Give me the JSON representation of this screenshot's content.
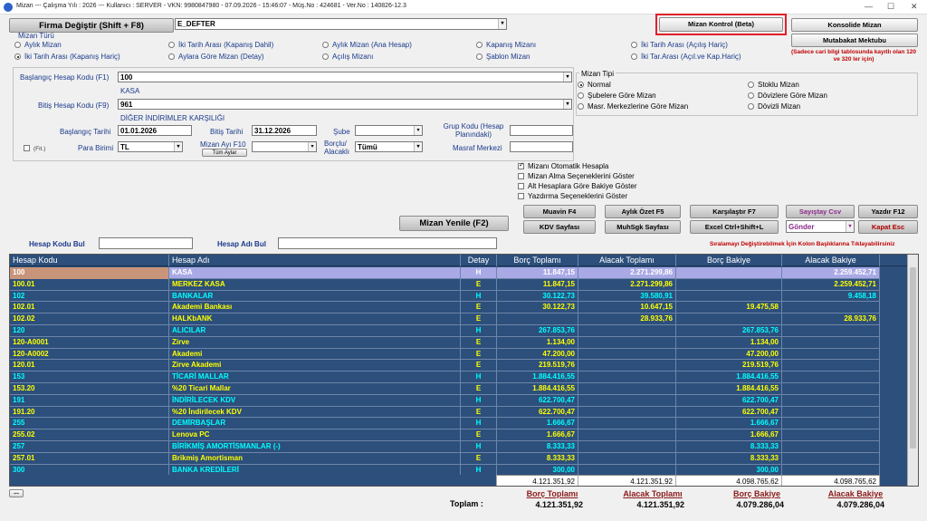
{
  "window": {
    "app_name": "Mizan",
    "info": "Mizan  ---  Çalışma Yılı : 2026  ---  Kullanıcı : SERVER - VKN: 9980847980 - 07.09.2026 - 15:46:07 - Müş.No : 424681 - Ver.No : 140826-12.3",
    "minimize": "—",
    "maximize": "☐",
    "close": "✕"
  },
  "toolbar": {
    "firma_degistir": "Firma Değiştir (Shift + F8)",
    "firma_value": "E_DEFTER",
    "mizan_kontrol": "Mizan Kontrol (Beta)",
    "konsolide": "Konsolide Mizan",
    "mutabakat": "Mutabakat Mektubu",
    "note": "(Sadece cari bilgi tablosunda kayıtlı olan 120 ve 320 ler için)"
  },
  "mizan_turu": {
    "label": "Mizan Türü",
    "options": [
      {
        "label": "Aylık Mizan",
        "selected": false
      },
      {
        "label": "İki Tarih Arası (Kapanış Dahil)",
        "selected": false
      },
      {
        "label": "Aylık Mizan (Ana Hesap)",
        "selected": false
      },
      {
        "label": "Kapanış Mizanı",
        "selected": false
      },
      {
        "label": "İki Tarih Arası (Açılış Hariç)",
        "selected": false
      },
      {
        "label": "İki Tarih Arası (Kapanış Hariç)",
        "selected": true
      },
      {
        "label": "Aylara Göre Mizan (Detay)",
        "selected": false
      },
      {
        "label": "Açılış Mizanı",
        "selected": false
      },
      {
        "label": "Şablon Mizan",
        "selected": false
      },
      {
        "label": "İki Tar.Arası (Açıl.ve Kap.Hariç)",
        "selected": false
      }
    ]
  },
  "filters": {
    "bas_hesap_label": "Başlangıç Hesap Kodu (F1)",
    "bas_hesap_value": "100",
    "bas_hesap_name": "KASA",
    "bit_hesap_label": "Bitiş Hesap Kodu (F9)",
    "bit_hesap_value": "961",
    "bit_hesap_name": "DİĞER İNDİRİMLER KARŞILIĞI",
    "bas_tarihi_label": "Başlangıç Tarihi",
    "bas_tarihi_value": "01.01.2026",
    "bit_tarihi_label": "Bitiş Tarihi",
    "bit_tarihi_value": "31.12.2026",
    "sube_label": "Şube",
    "sube_value": "",
    "grup_kodu_label": "Grup Kodu   (Hesap Planındaki)",
    "grup_kodu_value": "",
    "fit_label": "(Fit.)",
    "para_birimi_label": "Para Birimi",
    "para_birimi_value": "TL",
    "mizan_ayi_label": "Mizan Ayı F10",
    "tum_aylar": "Tüm Aylar",
    "mizan_ayi_value": "",
    "borclu_label": "Borçlu/ Alacaklı",
    "borclu_value": "Tümü",
    "masraf_label": "Masraf Merkezi",
    "masraf_value": ""
  },
  "mizan_tipi": {
    "label": "Mizan Tipi",
    "options": [
      {
        "label": "Normal",
        "selected": true
      },
      {
        "label": "Stoklu Mizan",
        "selected": false
      },
      {
        "label": "Şubelere Göre Mizan",
        "selected": false
      },
      {
        "label": "Dövizlere Göre Mizan",
        "selected": false
      },
      {
        "label": "Masr. Merkezlerine Göre Mizan",
        "selected": false
      },
      {
        "label": "Dövizli Mizan",
        "selected": false
      }
    ]
  },
  "options": [
    {
      "label": "Mizanı Otomatik Hesapla",
      "checked": true
    },
    {
      "label": "Mizan Alma Seçeneklerini Göster",
      "checked": false
    },
    {
      "label": "Alt Hesaplara Göre Bakiye Göster",
      "checked": false
    },
    {
      "label": "Yazdırma Seçeneklerini Göster",
      "checked": false
    }
  ],
  "actions": {
    "mizan_yenile": "Mizan Yenile (F2)",
    "muavin": "Muavin F4",
    "aylik_ozet": "Aylık Özet F5",
    "karsilastir": "Karşılaştır F7",
    "sayistay": "Sayıştay Csv",
    "yazdir": "Yazdır F12",
    "kdv": "KDV Sayfası",
    "muhsgk": "MuhSgk Sayfası",
    "excel": "Excel Ctrl+Shift+L",
    "gonder": "Gönder",
    "kapat": "Kapat Esc"
  },
  "search": {
    "hesap_kodu_label": "Hesap Kodu Bul",
    "hesap_kodu_value": "",
    "hesap_adi_label": "Hesap Adı Bul",
    "hesap_adi_value": "",
    "sort_hint": "Sıralamayı Değiştirebilmek İçin Kolon Başlıklarına Tıklayabilirsiniz"
  },
  "table": {
    "headers": [
      "Hesap Kodu",
      "Hesap Adı",
      "Detay",
      "Borç Toplamı",
      "Alacak Toplamı",
      "Borç Bakiye",
      "Alacak Bakiye"
    ],
    "rows": [
      {
        "code": "100",
        "name": "KASA",
        "detay": "H",
        "borc": "11.847,15",
        "alacak": "2.271.299,86",
        "borc_bak": "",
        "alacak_bak": "2.259.452,71",
        "color": "#ffffff",
        "selected": true
      },
      {
        "code": "100.01",
        "name": "MERKEZ KASA",
        "detay": "E",
        "borc": "11.847,15",
        "alacak": "2.271.299,86",
        "borc_bak": "",
        "alacak_bak": "2.259.452,71",
        "color": "#ffff00"
      },
      {
        "code": "102",
        "name": "BANKALAR",
        "detay": "H",
        "borc": "30.122,73",
        "alacak": "39.580,91",
        "borc_bak": "",
        "alacak_bak": "9.458,18",
        "color": "#00ffff"
      },
      {
        "code": "102.01",
        "name": "Akademi Bankası",
        "detay": "E",
        "borc": "30.122,73",
        "alacak": "10.647,15",
        "borc_bak": "19.475,58",
        "alacak_bak": "",
        "color": "#ffff00"
      },
      {
        "code": "102.02",
        "name": "HALKbANK",
        "detay": "E",
        "borc": "",
        "alacak": "28.933,76",
        "borc_bak": "",
        "alacak_bak": "28.933,76",
        "color": "#ffff00"
      },
      {
        "code": "120",
        "name": "ALICILAR",
        "detay": "H",
        "borc": "267.853,76",
        "alacak": "",
        "borc_bak": "267.853,76",
        "alacak_bak": "",
        "color": "#00ffff"
      },
      {
        "code": "120-A0001",
        "name": "Zirve",
        "detay": "E",
        "borc": "1.134,00",
        "alacak": "",
        "borc_bak": "1.134,00",
        "alacak_bak": "",
        "color": "#ffff00"
      },
      {
        "code": "120-A0002",
        "name": "Akademi",
        "detay": "E",
        "borc": "47.200,00",
        "alacak": "",
        "borc_bak": "47.200,00",
        "alacak_bak": "",
        "color": "#ffff00"
      },
      {
        "code": "120.01",
        "name": "Zirve Akademi",
        "detay": "E",
        "borc": "219.519,76",
        "alacak": "",
        "borc_bak": "219.519,76",
        "alacak_bak": "",
        "color": "#ffff00"
      },
      {
        "code": "153",
        "name": "TİCARİ MALLAR",
        "detay": "H",
        "borc": "1.884.416,55",
        "alacak": "",
        "borc_bak": "1.884.416,55",
        "alacak_bak": "",
        "color": "#00ffff"
      },
      {
        "code": "153.20",
        "name": "%20 Ticari Mallar",
        "detay": "E",
        "borc": "1.884.416,55",
        "alacak": "",
        "borc_bak": "1.884.416,55",
        "alacak_bak": "",
        "color": "#ffff00"
      },
      {
        "code": "191",
        "name": "İNDİRİLECEK KDV",
        "detay": "H",
        "borc": "622.700,47",
        "alacak": "",
        "borc_bak": "622.700,47",
        "alacak_bak": "",
        "color": "#00ffff"
      },
      {
        "code": "191.20",
        "name": "%20 İndirilecek KDV",
        "detay": "E",
        "borc": "622.700,47",
        "alacak": "",
        "borc_bak": "622.700,47",
        "alacak_bak": "",
        "color": "#ffff00"
      },
      {
        "code": "255",
        "name": "DEMİRBAŞLAR",
        "detay": "H",
        "borc": "1.666,67",
        "alacak": "",
        "borc_bak": "1.666,67",
        "alacak_bak": "",
        "color": "#00ffff"
      },
      {
        "code": "255.02",
        "name": "Lenova PC",
        "detay": "E",
        "borc": "1.666,67",
        "alacak": "",
        "borc_bak": "1.666,67",
        "alacak_bak": "",
        "color": "#ffff00"
      },
      {
        "code": "257",
        "name": "BİRİKMİŞ AMORTİSMANLAR (-)",
        "detay": "H",
        "borc": "8.333,33",
        "alacak": "",
        "borc_bak": "8.333,33",
        "alacak_bak": "",
        "color": "#00ffff"
      },
      {
        "code": "257.01",
        "name": "Brikmiş Amortisman",
        "detay": "E",
        "borc": "8.333,33",
        "alacak": "",
        "borc_bak": "8.333,33",
        "alacak_bak": "",
        "color": "#ffff00"
      },
      {
        "code": "300",
        "name": "BANKA KREDİLERİ",
        "detay": "H",
        "borc": "300,00",
        "alacak": "",
        "borc_bak": "300,00",
        "alacak_bak": "",
        "color": "#00ffff"
      }
    ],
    "totals": [
      "4.121.351,92",
      "4.121.351,92",
      "4.098.765,62",
      "4.098.765,62"
    ]
  },
  "footer": {
    "more": "...",
    "toplam_label": "Toplam :",
    "headers": [
      "Borç Toplamı",
      "Alacak Toplamı",
      "Borç Bakiye",
      "Alacak Bakiye"
    ],
    "values": [
      "4.121.351,92",
      "4.121.351,92",
      "4.079.286,04",
      "4.079.286,04"
    ]
  }
}
